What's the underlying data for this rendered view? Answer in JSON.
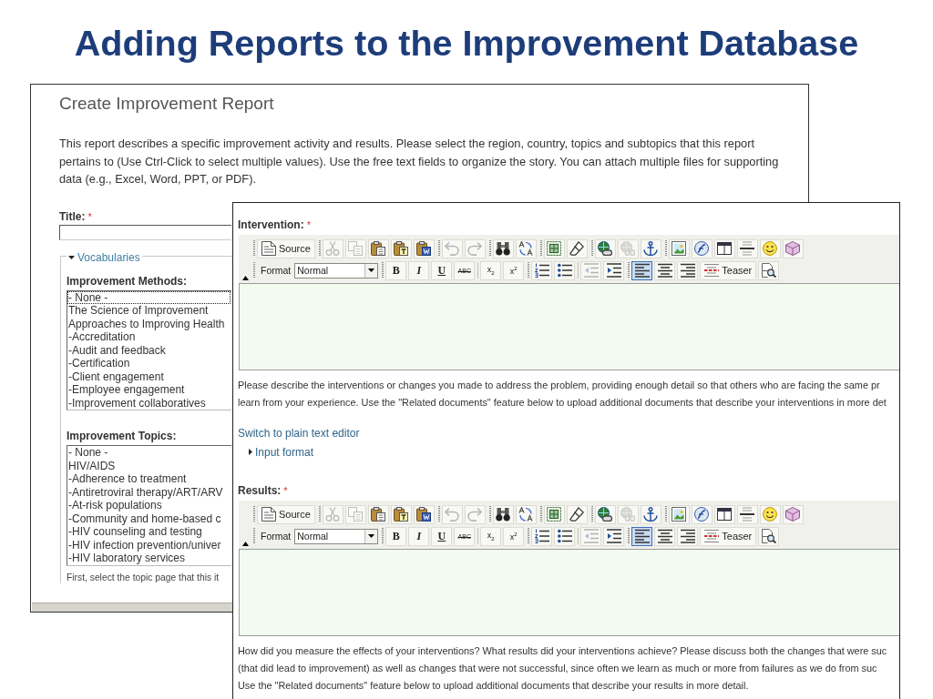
{
  "slide_title": "Adding Reports to the Improvement Database",
  "create_report": {
    "heading": "Create Improvement Report",
    "description": "This report describes a specific improvement activity and results. Please select the region, country, topics and subtopics that this report pertains to (Use Ctrl-Click to select multiple values). Use the free text fields to organize the story. You can attach multiple files for supporting data (e.g., Excel, Word, PPT, or PDF).",
    "title_field": {
      "label": "Title:",
      "required_mark": "*"
    },
    "vocabularies": {
      "legend": "Vocabularies",
      "expanded": true,
      "lists": [
        {
          "label": "Improvement Methods:",
          "options": [
            {
              "text": "- None -",
              "focused": true
            },
            {
              "text": "The Science of Improvement",
              "focused": false
            },
            {
              "text": "Approaches to Improving Health",
              "focused": false
            },
            {
              "text": "-Accreditation",
              "focused": false
            },
            {
              "text": "-Audit and feedback",
              "focused": false
            },
            {
              "text": "-Certification",
              "focused": false
            },
            {
              "text": "-Client engagement",
              "focused": false
            },
            {
              "text": "-Employee engagement",
              "focused": false
            },
            {
              "text": "-Improvement collaboratives",
              "focused": false
            }
          ]
        },
        {
          "label": "Improvement Topics:",
          "options": [
            {
              "text": "- None -",
              "focused": false
            },
            {
              "text": "HIV/AIDS",
              "focused": false
            },
            {
              "text": "-Adherence to treatment",
              "focused": false
            },
            {
              "text": "-Antiretroviral therapy/ART/ARV",
              "focused": false
            },
            {
              "text": "-At-risk populations",
              "focused": false
            },
            {
              "text": "-Community and home-based c",
              "focused": false
            },
            {
              "text": "-HIV counseling and testing",
              "focused": false
            },
            {
              "text": "-HIV infection prevention/univer",
              "focused": false
            },
            {
              "text": "-HIV laboratory services",
              "focused": false
            }
          ]
        }
      ],
      "hint": "First, select the topic page that this it"
    }
  },
  "editor_form": {
    "fields": [
      {
        "label": "Intervention:",
        "required_mark": "*",
        "toolbar": [
          {
            "groups": [
              [
                {
                  "kind": "source",
                  "label": "Source",
                  "disabled": false,
                  "on": false
                }
              ],
              [
                {
                  "kind": "cut",
                  "disabled": true,
                  "on": false
                },
                {
                  "kind": "copy",
                  "disabled": true,
                  "on": false
                },
                {
                  "kind": "paste",
                  "disabled": false,
                  "on": false
                },
                {
                  "kind": "pastetext",
                  "disabled": false,
                  "on": false
                },
                {
                  "kind": "pasteword",
                  "disabled": false,
                  "on": false
                }
              ],
              [
                {
                  "kind": "undo",
                  "disabled": true,
                  "on": false
                },
                {
                  "kind": "redo",
                  "disabled": true,
                  "on": false
                }
              ],
              [
                {
                  "kind": "find",
                  "disabled": false,
                  "on": false
                },
                {
                  "kind": "replace",
                  "disabled": false,
                  "on": false
                }
              ],
              [
                {
                  "kind": "selectall",
                  "disabled": false,
                  "on": false
                },
                {
                  "kind": "removeformat",
                  "disabled": false,
                  "on": false
                }
              ],
              [
                {
                  "kind": "link",
                  "disabled": false,
                  "on": false
                },
                {
                  "kind": "unlink",
                  "disabled": true,
                  "on": false
                },
                {
                  "kind": "anchor",
                  "disabled": false,
                  "on": false
                }
              ],
              [
                {
                  "kind": "image",
                  "disabled": false,
                  "on": false
                },
                {
                  "kind": "flash",
                  "disabled": false,
                  "on": false
                },
                {
                  "kind": "table",
                  "disabled": false,
                  "on": false
                },
                {
                  "kind": "rule",
                  "disabled": false,
                  "on": false
                },
                {
                  "kind": "smiley",
                  "disabled": false,
                  "on": false
                },
                {
                  "kind": "special",
                  "disabled": false,
                  "on": false
                }
              ]
            ]
          },
          {
            "groups": [
              [
                {
                  "kind": "format",
                  "label": "Format",
                  "value": "Normal"
                }
              ],
              [
                {
                  "kind": "bold",
                  "label": "B",
                  "disabled": false,
                  "on": false
                },
                {
                  "kind": "italic",
                  "label": "I",
                  "disabled": false,
                  "on": false
                },
                {
                  "kind": "underline",
                  "label": "U",
                  "disabled": false,
                  "on": false
                },
                {
                  "kind": "strike",
                  "label": "ABC",
                  "disabled": false,
                  "on": false
                },
                {
                  "kind": "separator"
                },
                {
                  "kind": "subscript",
                  "label": "x$_{2}$",
                  "disabled": false,
                  "on": false
                },
                {
                  "kind": "superscript",
                  "label": "x$^{2}$",
                  "disabled": false,
                  "on": false
                }
              ],
              [
                {
                  "kind": "orderedlist",
                  "disabled": false,
                  "on": false
                },
                {
                  "kind": "bulletlist",
                  "disabled": false,
                  "on": false
                },
                {
                  "kind": "separator"
                },
                {
                  "kind": "outdent",
                  "disabled": true,
                  "on": false
                },
                {
                  "kind": "indent",
                  "disabled": false,
                  "on": false
                }
              ],
              [
                {
                  "kind": "alignleft",
                  "disabled": false,
                  "on": true
                },
                {
                  "kind": "aligncenter",
                  "disabled": false,
                  "on": false
                },
                {
                  "kind": "alignright",
                  "disabled": false,
                  "on": false
                },
                {
                  "kind": "teaser",
                  "label": "Teaser",
                  "disabled": false,
                  "on": false
                },
                {
                  "kind": "preview",
                  "disabled": false,
                  "on": false
                }
              ]
            ]
          }
        ],
        "help_lines": [
          "Please describe the interventions or changes you made to address the problem, providing enough detail so that others who are facing the same pr",
          "learn from your experience. Use the \"Related documents\" feature below to upload additional documents that describe your interventions in more det"
        ],
        "switch_link": "Switch to plain text editor",
        "input_format": {
          "label": "Input format",
          "expanded": false
        }
      },
      {
        "label": "Results:",
        "required_mark": "*",
        "toolbar": [
          {
            "groups": [
              [
                {
                  "kind": "source",
                  "label": "Source",
                  "disabled": false,
                  "on": false
                }
              ],
              [
                {
                  "kind": "cut",
                  "disabled": true,
                  "on": false
                },
                {
                  "kind": "copy",
                  "disabled": true,
                  "on": false
                },
                {
                  "kind": "paste",
                  "disabled": false,
                  "on": false
                },
                {
                  "kind": "pastetext",
                  "disabled": false,
                  "on": false
                },
                {
                  "kind": "pasteword",
                  "disabled": false,
                  "on": false
                }
              ],
              [
                {
                  "kind": "undo",
                  "disabled": true,
                  "on": false
                },
                {
                  "kind": "redo",
                  "disabled": true,
                  "on": false
                }
              ],
              [
                {
                  "kind": "find",
                  "disabled": false,
                  "on": false
                },
                {
                  "kind": "replace",
                  "disabled": false,
                  "on": false
                }
              ],
              [
                {
                  "kind": "selectall",
                  "disabled": false,
                  "on": false
                },
                {
                  "kind": "removeformat",
                  "disabled": false,
                  "on": false
                }
              ],
              [
                {
                  "kind": "link",
                  "disabled": false,
                  "on": false
                },
                {
                  "kind": "unlink",
                  "disabled": true,
                  "on": false
                },
                {
                  "kind": "anchor",
                  "disabled": false,
                  "on": false
                }
              ],
              [
                {
                  "kind": "image",
                  "disabled": false,
                  "on": false
                },
                {
                  "kind": "flash",
                  "disabled": false,
                  "on": false
                },
                {
                  "kind": "table",
                  "disabled": false,
                  "on": false
                },
                {
                  "kind": "rule",
                  "disabled": false,
                  "on": false
                },
                {
                  "kind": "smiley",
                  "disabled": false,
                  "on": false
                },
                {
                  "kind": "special",
                  "disabled": false,
                  "on": false
                }
              ]
            ]
          },
          {
            "groups": [
              [
                {
                  "kind": "format",
                  "label": "Format",
                  "value": "Normal"
                }
              ],
              [
                {
                  "kind": "bold",
                  "label": "B",
                  "disabled": false,
                  "on": false
                },
                {
                  "kind": "italic",
                  "label": "I",
                  "disabled": false,
                  "on": false
                },
                {
                  "kind": "underline",
                  "label": "U",
                  "disabled": false,
                  "on": false
                },
                {
                  "kind": "strike",
                  "label": "ABC",
                  "disabled": false,
                  "on": false
                },
                {
                  "kind": "separator"
                },
                {
                  "kind": "subscript",
                  "label": "x$_{2}$",
                  "disabled": false,
                  "on": false
                },
                {
                  "kind": "superscript",
                  "label": "x$^{2}$",
                  "disabled": false,
                  "on": false
                }
              ],
              [
                {
                  "kind": "orderedlist",
                  "disabled": false,
                  "on": false
                },
                {
                  "kind": "bulletlist",
                  "disabled": false,
                  "on": false
                },
                {
                  "kind": "separator"
                },
                {
                  "kind": "outdent",
                  "disabled": true,
                  "on": false
                },
                {
                  "kind": "indent",
                  "disabled": false,
                  "on": false
                }
              ],
              [
                {
                  "kind": "alignleft",
                  "disabled": false,
                  "on": true
                },
                {
                  "kind": "aligncenter",
                  "disabled": false,
                  "on": false
                },
                {
                  "kind": "alignright",
                  "disabled": false,
                  "on": false
                },
                {
                  "kind": "teaser",
                  "label": "Teaser",
                  "disabled": false,
                  "on": false
                },
                {
                  "kind": "preview",
                  "disabled": false,
                  "on": false
                }
              ]
            ]
          }
        ],
        "help_lines": [
          "How did you measure the effects of your interventions? What results did your interventions achieve? Please discuss both the changes that were suc",
          "(that did lead to improvement) as well as changes that were not successful, since often we learn as much or more from failures as we do from suc",
          "Use the \"Related documents\" feature below to upload additional documents that describe your results in more detail."
        ]
      }
    ]
  }
}
